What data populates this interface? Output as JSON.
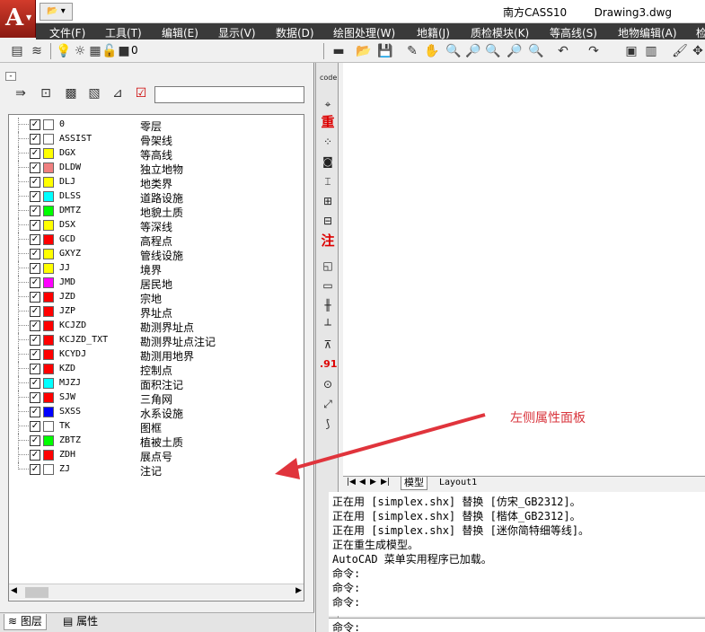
{
  "title_bar": {
    "app_name": "南方CASS10",
    "document": "Drawing3.dwg"
  },
  "menu": [
    "文件(F)",
    "工具(T)",
    "编辑(E)",
    "显示(V)",
    "数据(D)",
    "绘图处理(W)",
    "地籍(J)",
    "质检模块(K)",
    "等高线(S)",
    "地物编辑(A)",
    "检"
  ],
  "layer_toolbar": {
    "current_layer": "0"
  },
  "layers": [
    {
      "code": "0",
      "name": "零层",
      "color": "#ffffff"
    },
    {
      "code": "ASSIST",
      "name": "骨架线",
      "color": "#ffffff"
    },
    {
      "code": "DGX",
      "name": "等高线",
      "color": "#ffff00"
    },
    {
      "code": "DLDW",
      "name": "独立地物",
      "color": "#f08080"
    },
    {
      "code": "DLJ",
      "name": "地类界",
      "color": "#ffff00"
    },
    {
      "code": "DLSS",
      "name": "道路设施",
      "color": "#00ffff"
    },
    {
      "code": "DMTZ",
      "name": "地貌土质",
      "color": "#00ff00"
    },
    {
      "code": "DSX",
      "name": "等深线",
      "color": "#ffff00"
    },
    {
      "code": "GCD",
      "name": "高程点",
      "color": "#ff0000"
    },
    {
      "code": "GXYZ",
      "name": "管线设施",
      "color": "#ffff00"
    },
    {
      "code": "JJ",
      "name": "境界",
      "color": "#ffff00"
    },
    {
      "code": "JMD",
      "name": "居民地",
      "color": "#ff00ff"
    },
    {
      "code": "JZD",
      "name": "宗地",
      "color": "#ff0000"
    },
    {
      "code": "JZP",
      "name": "界址点",
      "color": "#ff0000"
    },
    {
      "code": "KCJZD",
      "name": "勘测界址点",
      "color": "#ff0000"
    },
    {
      "code": "KCJZD_TXT",
      "name": "勘测界址点注记",
      "color": "#ff0000"
    },
    {
      "code": "KCYDJ",
      "name": "勘测用地界",
      "color": "#ff0000"
    },
    {
      "code": "KZD",
      "name": "控制点",
      "color": "#ff0000"
    },
    {
      "code": "MJZJ",
      "name": "面积注记",
      "color": "#00ffff"
    },
    {
      "code": "SJW",
      "name": "三角网",
      "color": "#ff0000"
    },
    {
      "code": "SXSS",
      "name": "水系设施",
      "color": "#0000ff"
    },
    {
      "code": "TK",
      "name": "图框",
      "color": "#ffffff"
    },
    {
      "code": "ZBTZ",
      "name": "植被土质",
      "color": "#00ff00"
    },
    {
      "code": "ZDH",
      "name": "展点号",
      "color": "#ff0000"
    },
    {
      "code": "ZJ",
      "name": "注记",
      "color": "#ffffff"
    }
  ],
  "panel_tabs": {
    "layers": "图层",
    "properties": "属性"
  },
  "vertical_toolbar": {
    "code": "code",
    "heavy": "重",
    "annot": "注",
    "num": ".91"
  },
  "model_tabs": {
    "model": "模型",
    "layout": "Layout1"
  },
  "command_log": [
    "正在用 [simplex.shx] 替换 [仿宋_GB2312]。",
    "正在用 [simplex.shx] 替换 [楷体_GB2312]。",
    "正在用 [simplex.shx] 替换 [迷你简特细等线]。",
    "正在重生成模型。",
    "AutoCAD 菜单实用程序已加载。",
    "命令:",
    "命令:",
    "命令:"
  ],
  "command_prompt": "命令:",
  "annotation": "左侧属性面板",
  "colors": {
    "menubar": "#3a3a3a",
    "annotation": "#d9363e"
  }
}
